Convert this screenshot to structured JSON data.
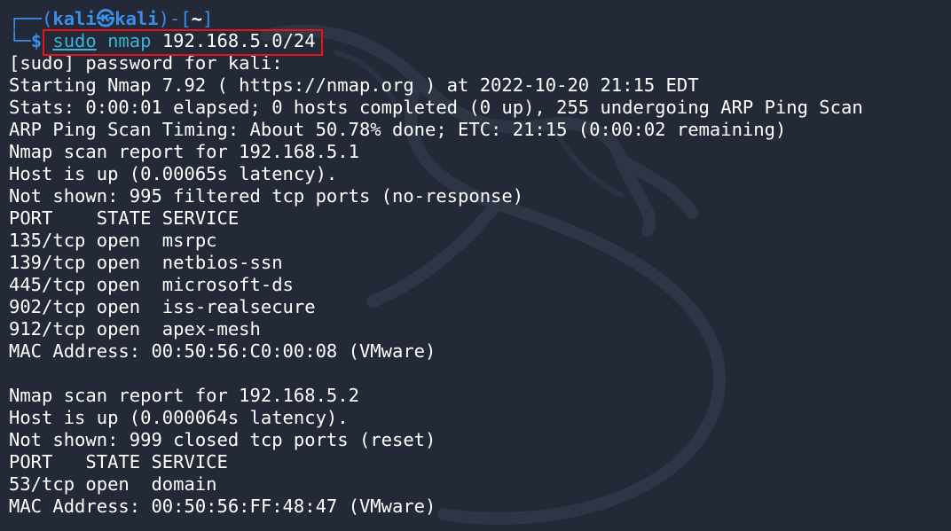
{
  "prompt": {
    "corner_top": "┌──(",
    "user": "kali",
    "at_symbol": "㉿",
    "host": "kali",
    "close_paren": ")-[",
    "cwd": "~",
    "close_bracket": "]",
    "corner_bottom": "└─",
    "dollar": "$",
    "cmd_sudo": "sudo",
    "cmd_nmap": "nmap",
    "cmd_arg": "192.168.5.0/24"
  },
  "output_lines": [
    "[sudo] password for kali:",
    "Starting Nmap 7.92 ( https://nmap.org ) at 2022-10-20 21:15 EDT",
    "Stats: 0:00:01 elapsed; 0 hosts completed (0 up), 255 undergoing ARP Ping Scan",
    "ARP Ping Scan Timing: About 50.78% done; ETC: 21:15 (0:00:02 remaining)",
    "Nmap scan report for 192.168.5.1",
    "Host is up (0.00065s latency).",
    "Not shown: 995 filtered tcp ports (no-response)",
    "PORT    STATE SERVICE",
    "135/tcp open  msrpc",
    "139/tcp open  netbios-ssn",
    "445/tcp open  microsoft-ds",
    "902/tcp open  iss-realsecure",
    "912/tcp open  apex-mesh",
    "MAC Address: 00:50:56:C0:00:08 (VMware)",
    "",
    "Nmap scan report for 192.168.5.2",
    "Host is up (0.000064s latency).",
    "Not shown: 999 closed tcp ports (reset)",
    "PORT   STATE SERVICE",
    "53/tcp open  domain",
    "MAC Address: 00:50:56:FF:48:47 (VMware)"
  ],
  "colors": {
    "background": "#232936",
    "prompt_blue": "#3b8eea",
    "command_cyan": "#39b5d6",
    "highlight_red": "#e8141a",
    "text": "#ffffff"
  },
  "icons": {
    "watermark": "kali-dragon-icon"
  }
}
